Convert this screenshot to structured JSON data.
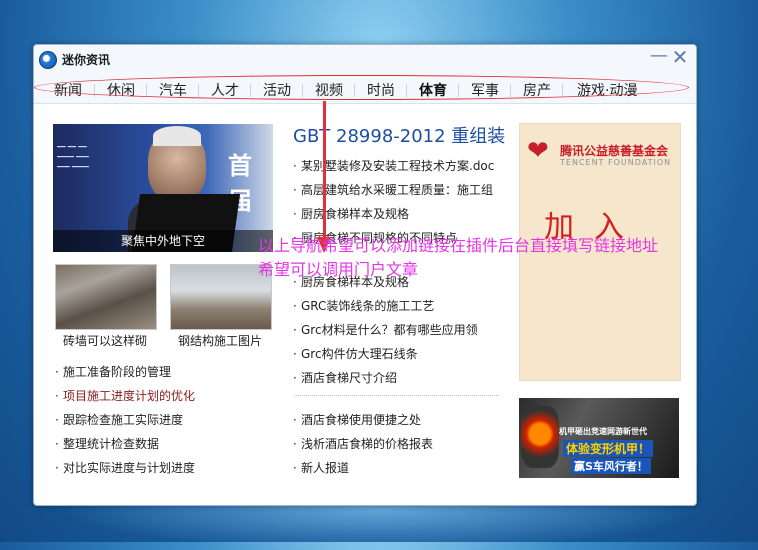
{
  "window": {
    "title": "迷你资讯"
  },
  "titlebar": {
    "minimize_glyph": "—",
    "close_glyph": "✕"
  },
  "nav": {
    "items": [
      "新闻",
      "休闲",
      "汽车",
      "人才",
      "活动",
      "视频",
      "时尚",
      "体育",
      "军事",
      "房产",
      "游戏·动漫"
    ],
    "active": "体育"
  },
  "featured": {
    "caption": "聚焦中外地下空",
    "banner_text": "首届"
  },
  "thumbs": [
    {
      "caption": "砖墙可以这样砌"
    },
    {
      "caption": "钢结构施工图片"
    }
  ],
  "left_list": [
    "施工准备阶段的管理",
    "项目施工进度计划的优化",
    "跟踪检查施工实际进度",
    "整理统计检查数据",
    "对比实际进度与计划进度"
  ],
  "headline": "GBT 28998-2012 重组装",
  "middle_list": [
    "某别墅装修及安装工程技术方案.doc",
    "高层建筑给水采暖工程质量：施工组",
    "厨房食梯样本及规格",
    "厨房食梯不同规格的不同特点",
    "厨房食梯样本及规格",
    "GRC装饰线条的施工工艺",
    "Grc材料是什么？都有哪些应用领",
    "Grc构件仿大理石线条",
    "酒店食梯尺寸介绍"
  ],
  "middle_list_bottom": [
    "酒店食梯使用便捷之处",
    "浅析酒店食梯的价格报表",
    "新人报道"
  ],
  "ad_charity": {
    "name_cn": "腾讯公益慈善基金会",
    "name_en": "TENCENT FOUNDATION",
    "cta": "加入"
  },
  "ad_game": {
    "line1": "机甲砸出竞速网游新世代",
    "line2": "体验变形机甲！",
    "line3": "赢S车风行者！"
  },
  "annotation": "以上导航希望可以添加链接在插件后台直接填写链接地址 希望可以调用门户文章",
  "colors": {
    "accent": "#e0303a",
    "annotation": "#e536e5",
    "headline": "#1c4fa0"
  }
}
